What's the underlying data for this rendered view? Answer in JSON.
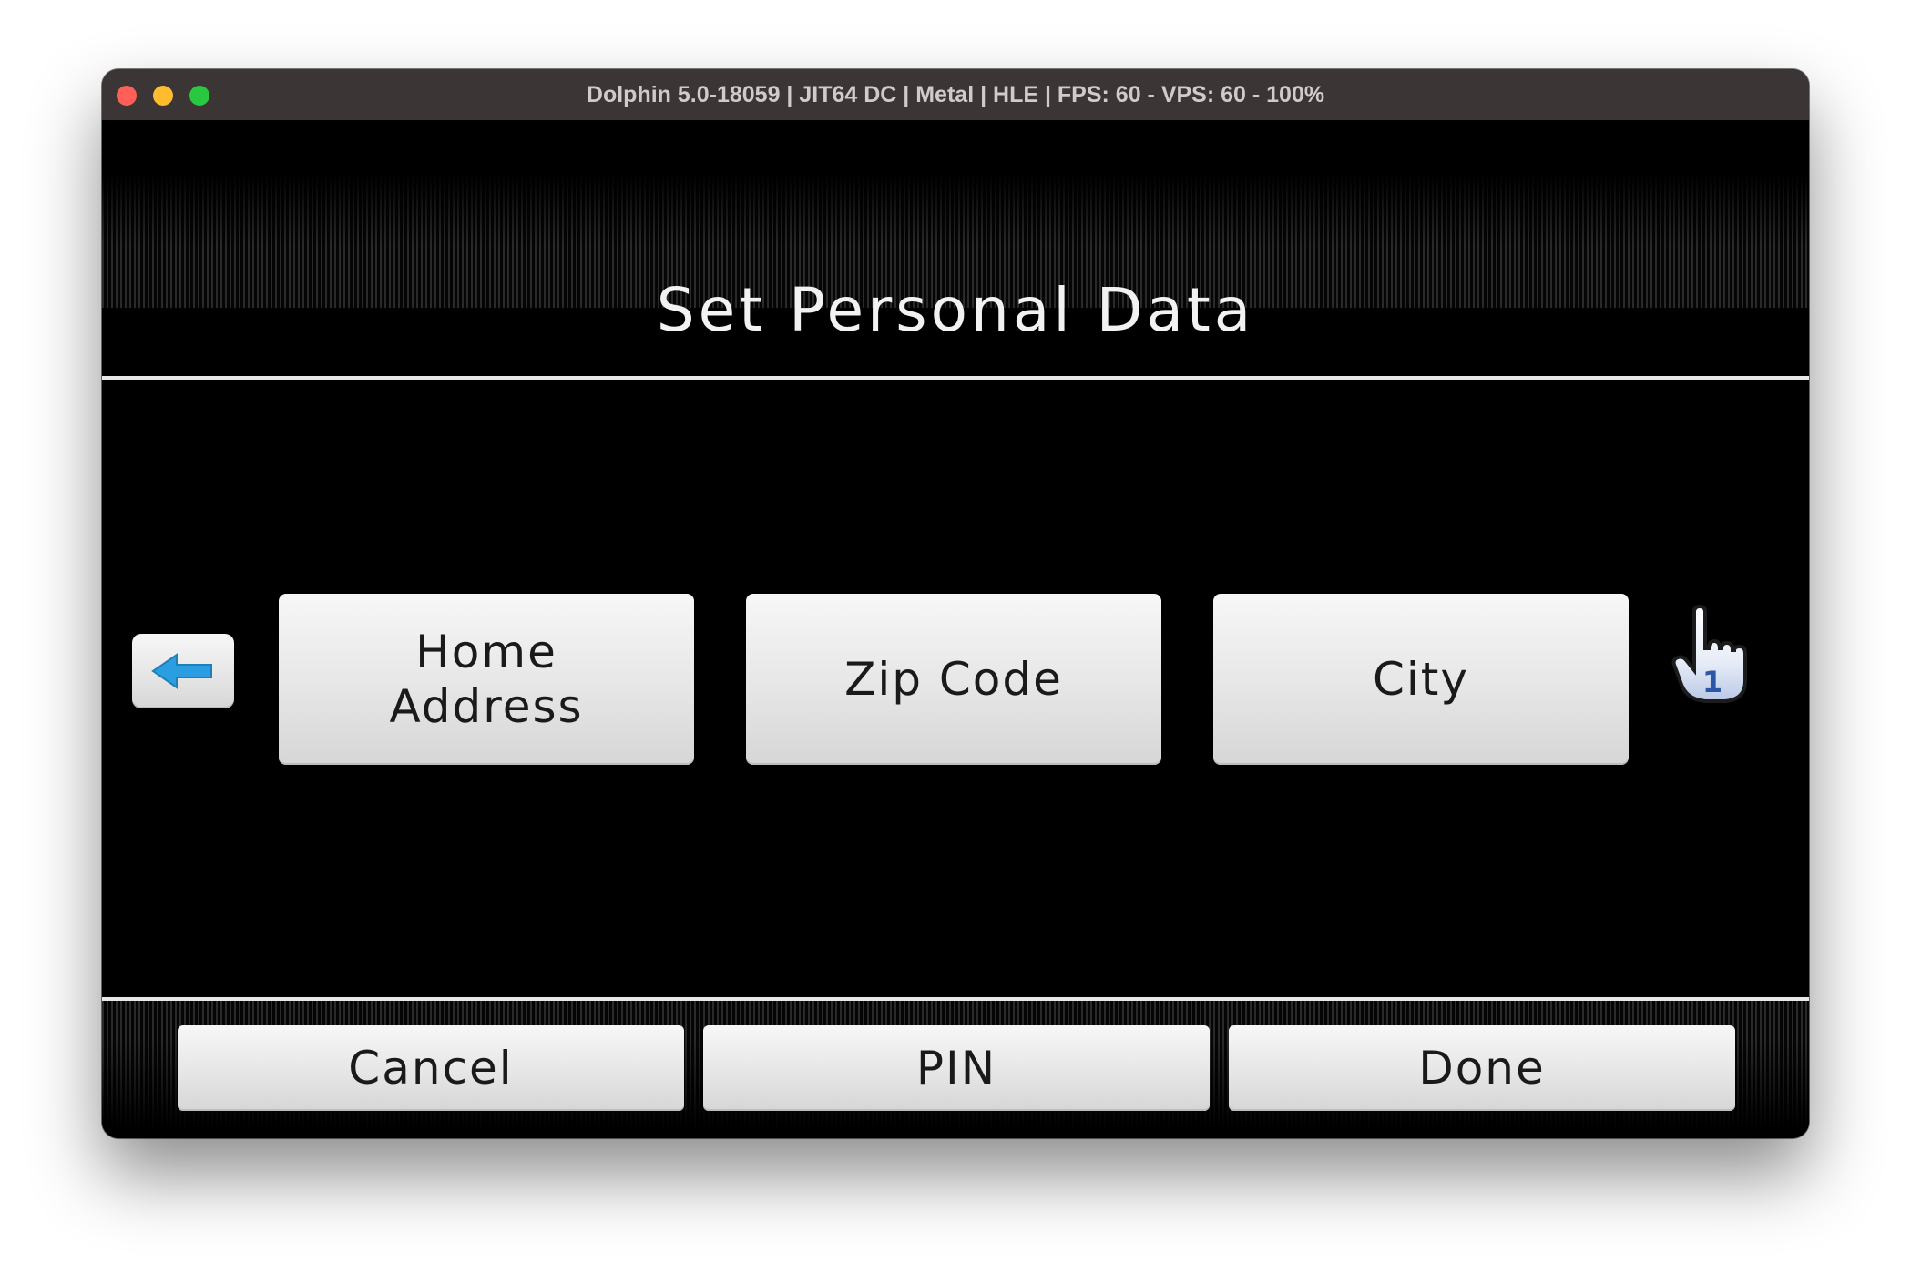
{
  "window": {
    "title": "Dolphin 5.0-18059 | JIT64 DC | Metal | HLE | FPS: 60 - VPS: 60 - 100%"
  },
  "screen": {
    "title": "Set Personal Data",
    "back_icon": "left-arrow-icon",
    "fields": [
      {
        "label": "Home\nAddress"
      },
      {
        "label": "Zip Code"
      },
      {
        "label": "City"
      }
    ],
    "pointer": {
      "icon": "hand-pointer-icon",
      "player": "1"
    }
  },
  "footer": {
    "cancel_label": "Cancel",
    "pin_label": "PIN",
    "done_label": "Done"
  },
  "colors": {
    "accent_arrow": "#2a9ee0",
    "button_face": "#e6e6e6",
    "background": "#000000"
  }
}
